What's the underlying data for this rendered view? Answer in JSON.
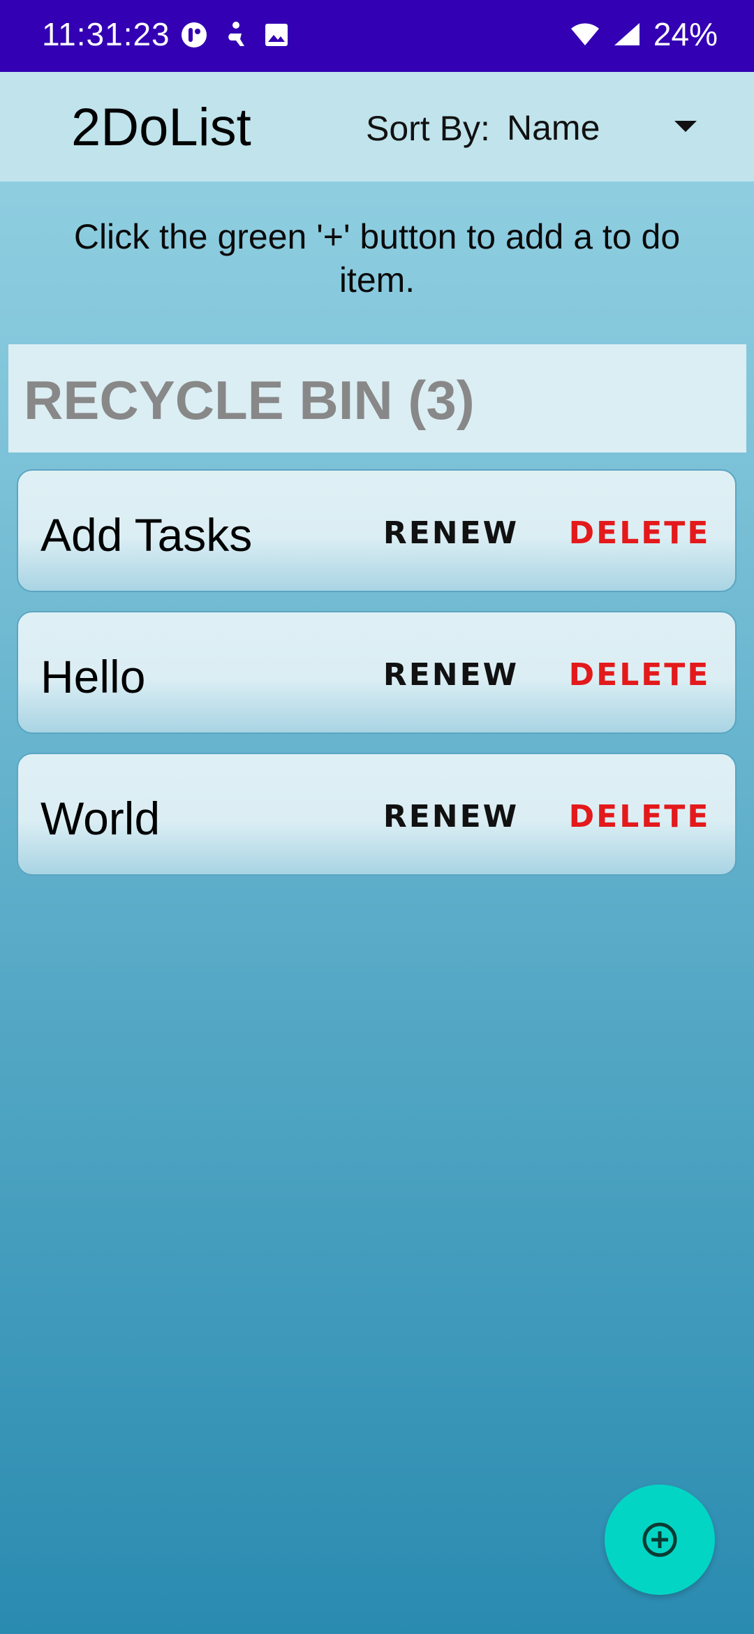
{
  "status_bar": {
    "time": "11:31:23",
    "battery": "24%",
    "icons": [
      "notification-app-icon",
      "accessibility-icon",
      "image-icon",
      "wifi-icon",
      "cell-signal-icon"
    ]
  },
  "app_bar": {
    "title": "2DoList",
    "sort_label": "Sort By:",
    "sort_value": "Name"
  },
  "hint": "Click the green '+' button to add a to do item.",
  "recycle_bin": {
    "title": "RECYCLE BIN (3)",
    "items": [
      {
        "label": "Add Tasks",
        "renew": "RENEW",
        "delete": "DELETE"
      },
      {
        "label": "Hello",
        "renew": "RENEW",
        "delete": "DELETE"
      },
      {
        "label": "World",
        "renew": "RENEW",
        "delete": "DELETE"
      }
    ]
  },
  "colors": {
    "status_bar": "#3300b3",
    "app_bar": "#c0e3ec",
    "fab": "#03d5c4",
    "delete": "#e3191b",
    "bin_title": "#888888"
  },
  "fab": {
    "icon": "add-circle-icon"
  }
}
